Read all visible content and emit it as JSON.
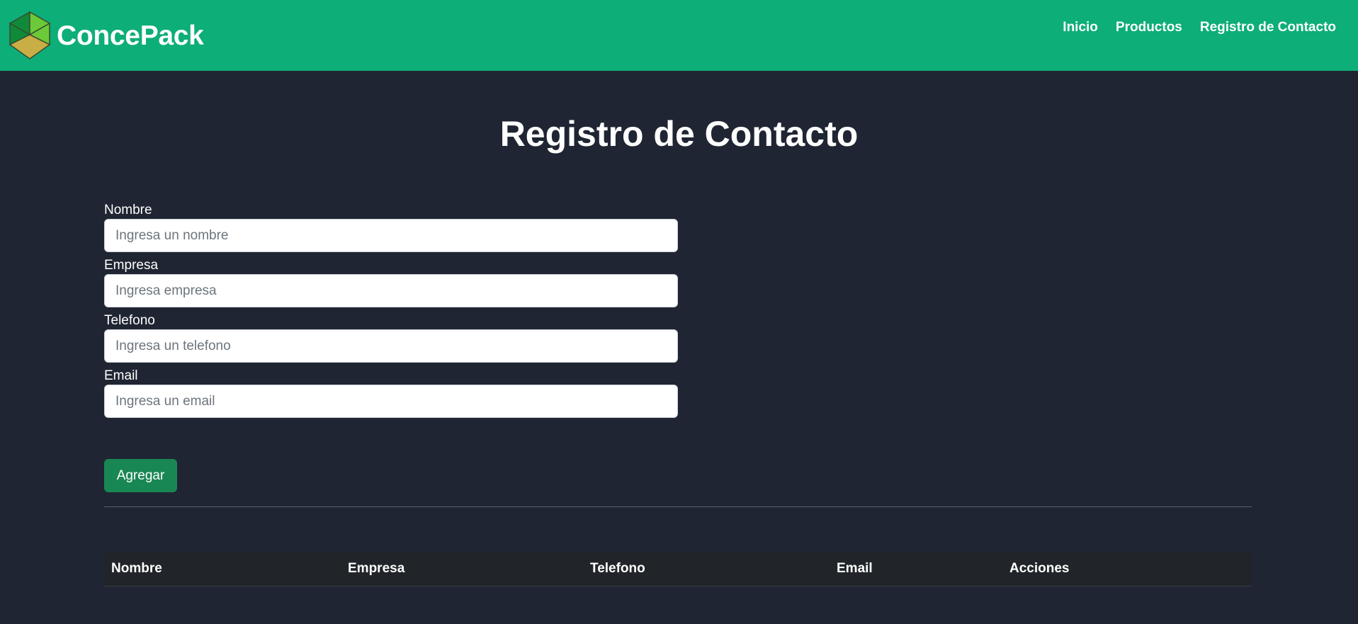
{
  "brand": {
    "name": "ConcePack",
    "colors": {
      "top_left": "#0f8a3a",
      "top_right": "#6cc93a",
      "bottom": "#c9ad45"
    }
  },
  "nav": {
    "background": "#0dae78",
    "links": [
      "Inicio",
      "Productos",
      "Registro de Contacto"
    ]
  },
  "page": {
    "title": "Registro de Contacto",
    "background": "#1f2532"
  },
  "form": {
    "fields": [
      {
        "label": "Nombre",
        "placeholder": "Ingresa un nombre",
        "value": ""
      },
      {
        "label": "Empresa",
        "placeholder": "Ingresa empresa",
        "value": ""
      },
      {
        "label": "Telefono",
        "placeholder": "Ingresa un telefono",
        "value": ""
      },
      {
        "label": "Email",
        "placeholder": "Ingresa un email",
        "value": ""
      }
    ],
    "submit_label": "Agregar",
    "submit_color": "#198754"
  },
  "table": {
    "columns": [
      "Nombre",
      "Empresa",
      "Telefono",
      "Email",
      "Acciones"
    ],
    "rows": []
  }
}
